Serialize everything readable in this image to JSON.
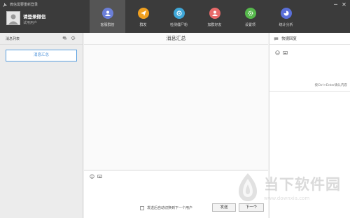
{
  "window": {
    "title": "微信需要重新登录",
    "controls": [
      "─",
      "✕"
    ]
  },
  "account": {
    "title": "请登录微信",
    "subtitle": "试用用户"
  },
  "nav": {
    "items": [
      {
        "label": "客服群管",
        "icon": "user-icon",
        "color": "#6b7fd8",
        "glyph": "●",
        "active": true
      },
      {
        "label": "群发",
        "icon": "send-icon",
        "color": "#f0a020",
        "glyph": "➤",
        "active": false
      },
      {
        "label": "检测僵尸粉",
        "icon": "scan-icon",
        "color": "#3fa7d8",
        "glyph": "◎",
        "active": false
      },
      {
        "label": "加群好友",
        "icon": "add-friend-icon",
        "color": "#e86a6a",
        "glyph": "●",
        "active": false
      },
      {
        "label": "设置项",
        "icon": "settings-icon",
        "color": "#56b84c",
        "glyph": "✿",
        "active": false
      },
      {
        "label": "统计分析",
        "icon": "analytics-icon",
        "color": "#5a6fd8",
        "glyph": "◐",
        "active": false
      }
    ]
  },
  "left": {
    "header": "消息列表",
    "summary_button": "消息汇总"
  },
  "center": {
    "title": "消息汇总",
    "auto_switch_label": "发送后自动切换到下一个用户",
    "send_label": "发送",
    "next_label": "下一个"
  },
  "right": {
    "header": "快捷回复",
    "hint": "按Ctrl+Enter确认内容"
  },
  "watermark": {
    "name": "当下软件园",
    "url": "www.downxia.com"
  }
}
